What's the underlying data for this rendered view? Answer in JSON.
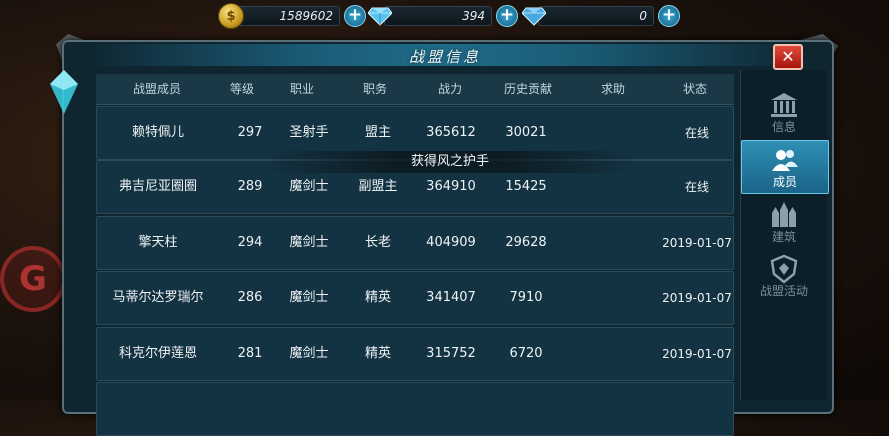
{
  "resources": {
    "gold": "1589602",
    "diamond": "394",
    "bound_diamond": "0",
    "gold_icon": "coin-icon",
    "diamond_icon": "diamond-icon"
  },
  "panel": {
    "title": "战盟信息"
  },
  "table": {
    "headers": [
      "战盟成员",
      "等级",
      "职业",
      "职务",
      "战力",
      "历史贡献",
      "求助",
      "状态"
    ],
    "rows": [
      {
        "name": "赖特佩儿",
        "level": "297",
        "class": "圣射手",
        "role": "盟主",
        "power": "365612",
        "contribution": "30021",
        "help": "",
        "status": "在线"
      },
      {
        "name": "弗吉尼亚圈圈",
        "level": "289",
        "class": "魔剑士",
        "role": "副盟主",
        "power": "364910",
        "contribution": "15425",
        "help": "",
        "status": "在线"
      },
      {
        "name": "擎天柱",
        "level": "294",
        "class": "魔剑士",
        "role": "长老",
        "power": "404909",
        "contribution": "29628",
        "help": "",
        "status": "2019-01-07"
      },
      {
        "name": "马蒂尔达罗瑞尔",
        "level": "286",
        "class": "魔剑士",
        "role": "精英",
        "power": "341407",
        "contribution": "7910",
        "help": "",
        "status": "2019-01-07"
      },
      {
        "name": "科克尔伊莲恩",
        "level": "281",
        "class": "魔剑士",
        "role": "精英",
        "power": "315752",
        "contribution": "6720",
        "help": "",
        "status": "2019-01-07"
      }
    ]
  },
  "toast": "获得风之护手",
  "tabs": [
    {
      "label": "信息",
      "icon": "temple-icon",
      "active": false
    },
    {
      "label": "成员",
      "icon": "members-icon",
      "active": true
    },
    {
      "label": "建筑",
      "icon": "castle-icon",
      "active": false
    },
    {
      "label": "战盟活动",
      "icon": "shield-emblem-icon",
      "active": false
    }
  ],
  "close_label": "✕",
  "colors": {
    "accent": "#2f8fb4",
    "close": "#c8231a",
    "panel": "#0f2530"
  }
}
